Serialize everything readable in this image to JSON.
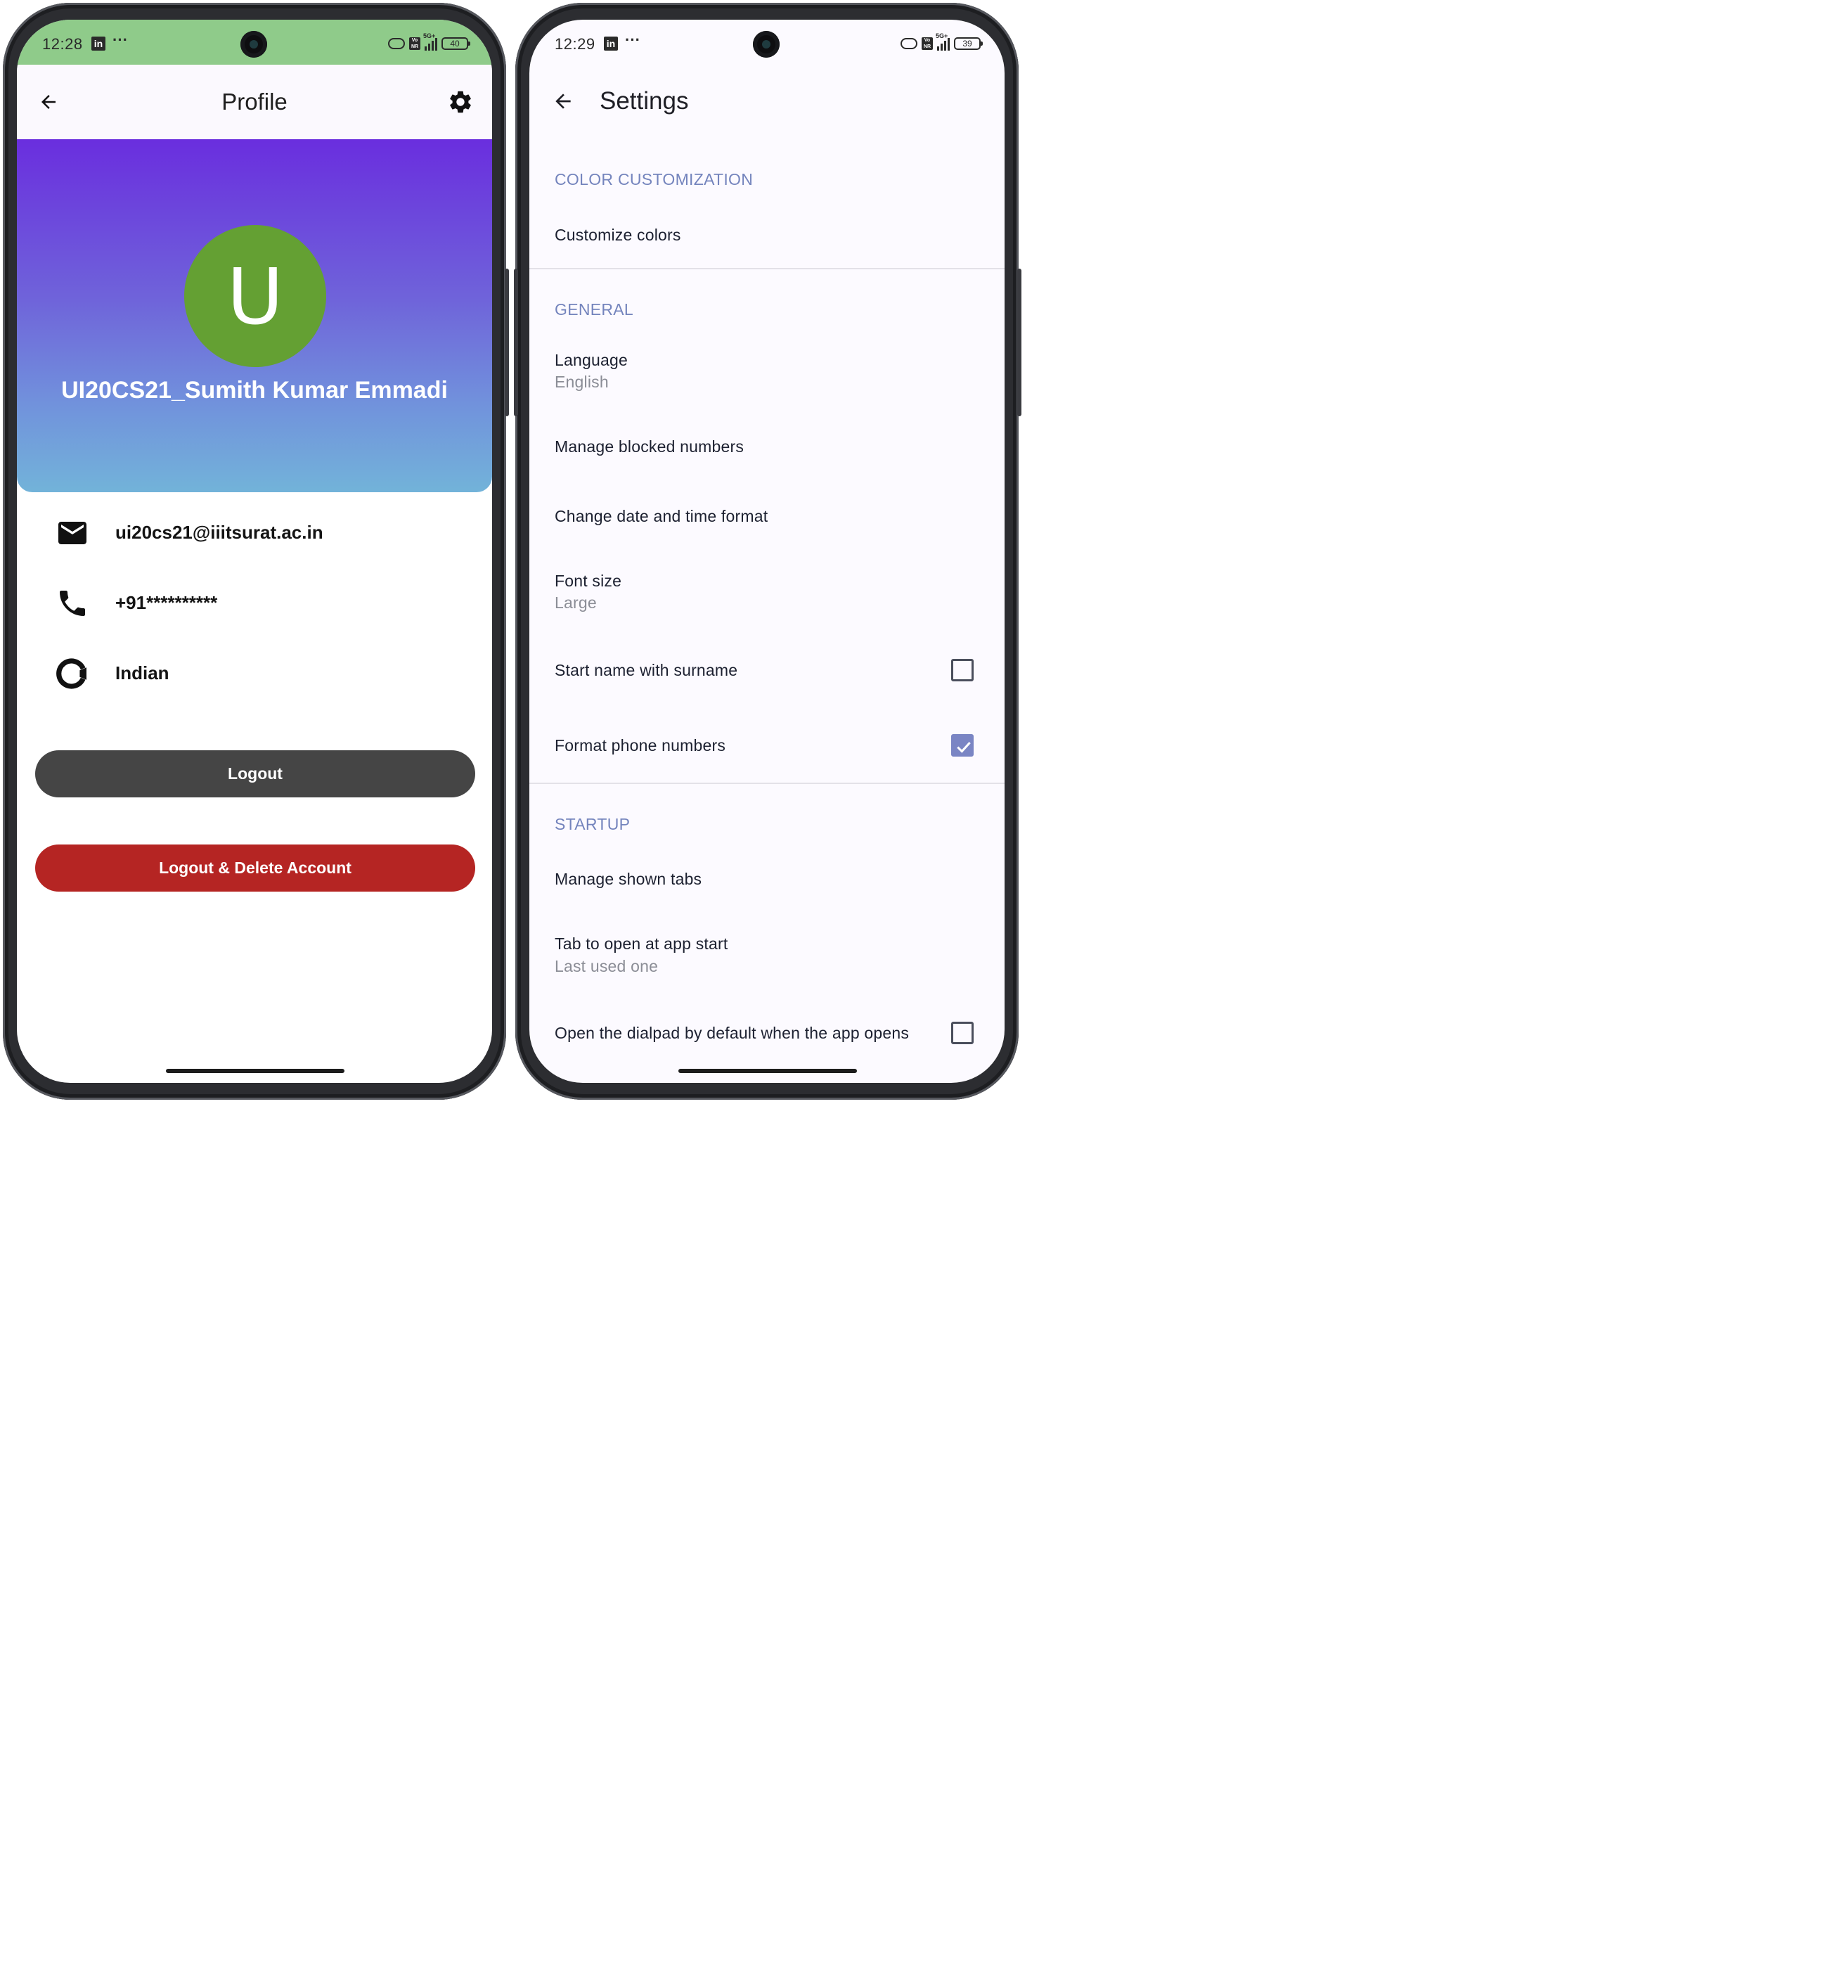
{
  "left_phone": {
    "status": {
      "time": "12:28",
      "battery": "40"
    },
    "appbar": {
      "title": "Profile"
    },
    "profile": {
      "avatar_initial": "U",
      "name": "UI20CS21_Sumith Kumar Emmadi",
      "email": "ui20cs21@iiitsurat.ac.in",
      "phone": "+91**********",
      "nationality": "Indian"
    },
    "buttons": {
      "logout": "Logout",
      "logout_delete": "Logout & Delete Account"
    }
  },
  "right_phone": {
    "status": {
      "time": "12:29",
      "battery": "39"
    },
    "appbar": {
      "title": "Settings"
    },
    "sections": {
      "color": {
        "header": "COLOR CUSTOMIZATION",
        "customize": "Customize colors"
      },
      "general": {
        "header": "GENERAL",
        "language": "Language",
        "language_value": "English",
        "blocked": "Manage blocked numbers",
        "date_format": "Change date and time format",
        "font_size": "Font size",
        "font_size_value": "Large",
        "surname": "Start name with surname",
        "surname_checked": false,
        "format_phone": "Format phone numbers",
        "format_phone_checked": true
      },
      "startup": {
        "header": "STARTUP",
        "tabs": "Manage shown tabs",
        "tab_open": "Tab to open at app start",
        "tab_open_value": "Last used one",
        "dialpad": "Open the dialpad by default when the app opens",
        "dialpad_checked": false
      }
    }
  },
  "colors": {
    "status_green": "#8fcb8a",
    "avatar_green": "#64a033",
    "hero_gradient_top": "#6a2ede",
    "hero_gradient_bottom": "#72b3d9",
    "logout_dark": "#454545",
    "delete_red": "#b52523",
    "section_header": "#7484bd"
  }
}
